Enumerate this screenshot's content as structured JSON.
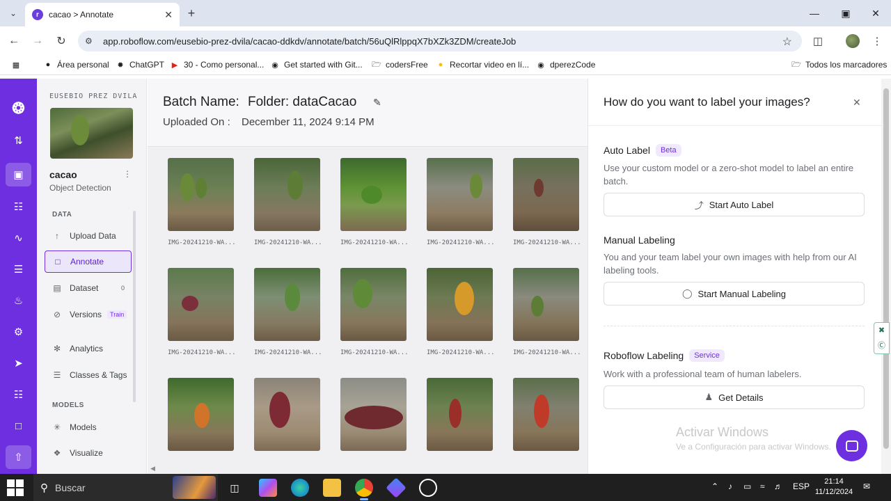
{
  "browser": {
    "tab_title": "cacao > Annotate",
    "favicon_letter": "r",
    "url": "app.roboflow.com/eusebio-prez-dvila/cacao-ddkdv/annotate/batch/56uQlRlppqX7bXZk3ZDM/createJob",
    "bookmarks": [
      {
        "label": "Área personal",
        "icon": "person-icon"
      },
      {
        "label": "ChatGPT",
        "icon": "chatgpt-icon"
      },
      {
        "label": "30 - Como personal...",
        "icon": "youtube-icon"
      },
      {
        "label": "Get started with Git...",
        "icon": "github-icon"
      },
      {
        "label": "codersFree",
        "icon": "folder-icon"
      },
      {
        "label": "Recortar video en lí...",
        "icon": "google-icon"
      },
      {
        "label": "dperezCode",
        "icon": "github-icon"
      }
    ],
    "all_bookmarks": "Todos los marcadores"
  },
  "sidebar": {
    "owner": "EUSEBIO PREZ DVILA",
    "project_name": "cacao",
    "project_type": "Object Detection",
    "data_section": "DATA",
    "items": [
      {
        "label": "Upload Data",
        "icon": "upload-icon"
      },
      {
        "label": "Annotate",
        "icon": "annotate-icon"
      },
      {
        "label": "Dataset",
        "icon": "dataset-icon",
        "badge": "0"
      },
      {
        "label": "Versions",
        "icon": "versions-icon",
        "badge": "Train"
      },
      {
        "label": "Analytics",
        "icon": "analytics-icon"
      },
      {
        "label": "Classes & Tags",
        "icon": "list-icon"
      }
    ],
    "models_section": "MODELS",
    "model_items": [
      {
        "label": "Models",
        "icon": "models-icon"
      },
      {
        "label": "Visualize",
        "icon": "visualize-icon"
      }
    ]
  },
  "batch": {
    "name_label": "Batch Name:",
    "name_value": "Folder: dataCacao",
    "uploaded_label": "Uploaded On :",
    "uploaded_value": "December 11, 2024 9:14 PM",
    "image_caption": "IMG-20241210-WA..."
  },
  "drawer": {
    "title": "How do you want to label your images?",
    "auto_title": "Auto Label",
    "auto_pill": "Beta",
    "auto_desc": "Use your custom model or a zero-shot model to label an entire batch.",
    "auto_button": "Start Auto Label",
    "manual_title": "Manual Labeling",
    "manual_desc": "You and your team label your own images with help from our AI labeling tools.",
    "manual_button": "Start Manual Labeling",
    "service_title": "Roboflow Labeling",
    "service_pill": "Service",
    "service_desc": "Work with a professional team of human labelers.",
    "service_button": "Get Details"
  },
  "watermark": {
    "line1": "Activar Windows",
    "line2": "Ve a Configuración para activar Windows."
  },
  "taskbar": {
    "search_placeholder": "Buscar",
    "language": "ESP",
    "time": "21:14",
    "date": "11/12/2024"
  },
  "colors": {
    "brand": "#6d2fe0",
    "pill_bg": "#f0e9fd"
  }
}
